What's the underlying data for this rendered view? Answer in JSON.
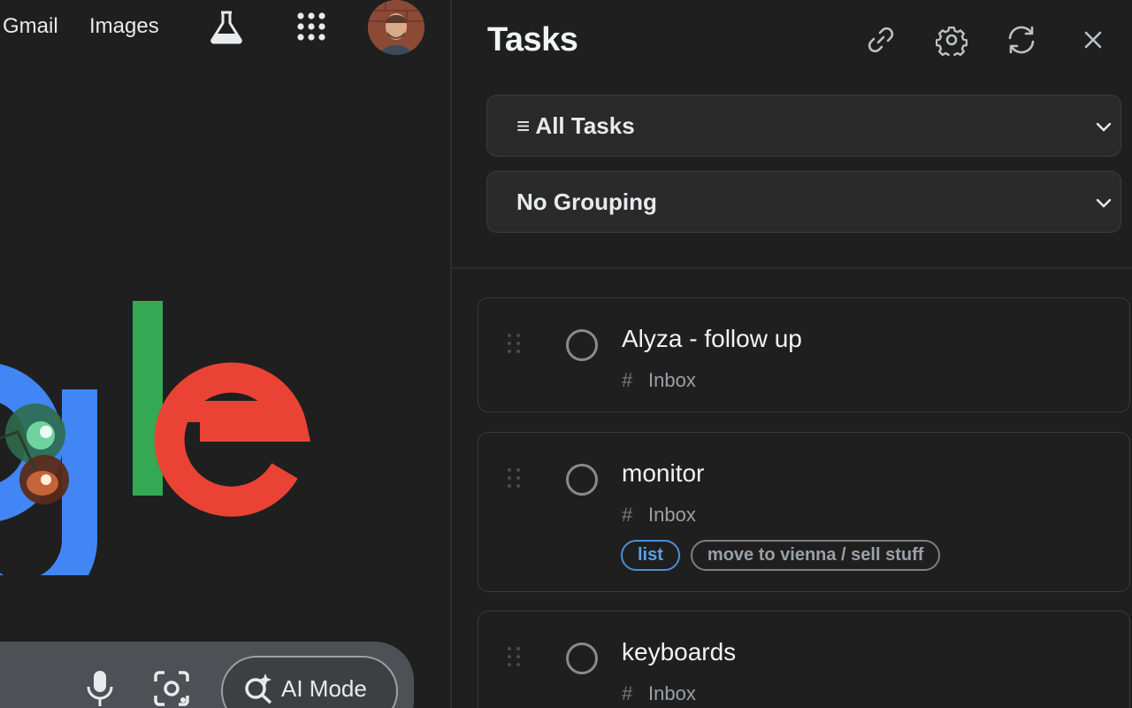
{
  "google": {
    "nav": {
      "gmail": "Gmail",
      "images": "Images"
    },
    "icons": {
      "labs": "flask-icon",
      "apps": "apps-grid-icon",
      "mic": "microphone-icon",
      "lens": "lens-icon",
      "ai": "sparkle-search-icon"
    },
    "ai_mode_label": "AI Mode",
    "logo_visible_text": "gle",
    "colors": {
      "g_blue": "#4285f4",
      "l_green": "#34a853",
      "e_red": "#ea4335"
    }
  },
  "tasks_panel": {
    "title": "Tasks",
    "header_icons": [
      "link-icon",
      "gear-icon",
      "sync-icon",
      "close-icon"
    ],
    "filter_select": "≡ All Tasks",
    "grouping_select": "No Grouping",
    "tasks": [
      {
        "title": "Alyza - follow up",
        "project": "Inbox",
        "tags": []
      },
      {
        "title": "monitor",
        "project": "Inbox",
        "tags": [
          "list",
          "move to vienna / sell stuff"
        ]
      },
      {
        "title": "keyboards",
        "project": "Inbox",
        "tags": []
      }
    ],
    "hash": "#",
    "colors": {
      "tag_accent": "#4a8fd6"
    }
  }
}
